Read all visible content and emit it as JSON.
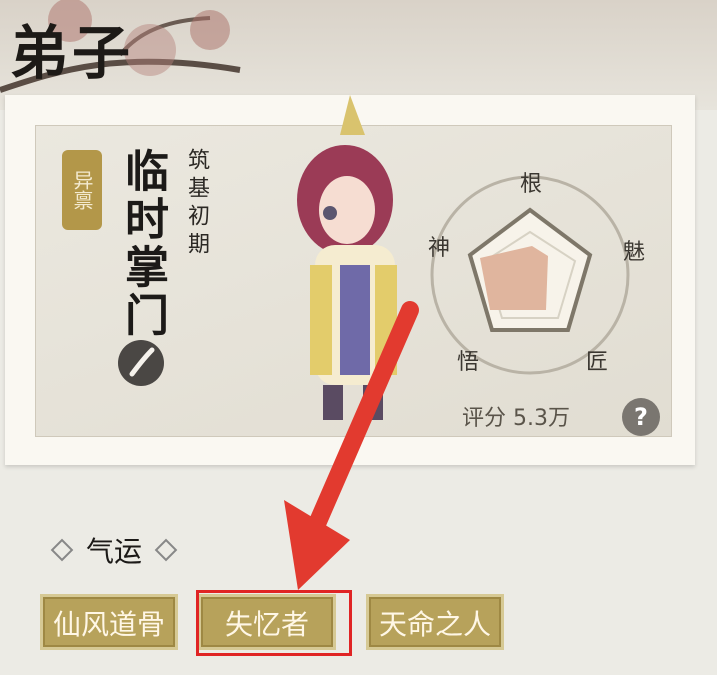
{
  "header": {
    "title": "弟子"
  },
  "card": {
    "badge": "异禀",
    "name": "临时掌门",
    "realm": "筑基初期",
    "radar_labels": [
      "根",
      "魅",
      "匠",
      "悟",
      "神"
    ],
    "score": "评分 5.3万",
    "help": "?"
  },
  "fortune": {
    "label": "气运",
    "tags": [
      "仙风道骨",
      "失忆者",
      "天命之人"
    ]
  },
  "colors": {
    "accent": "#b7a25b",
    "highlight": "#e02424",
    "arrow": "#e23a2f"
  }
}
